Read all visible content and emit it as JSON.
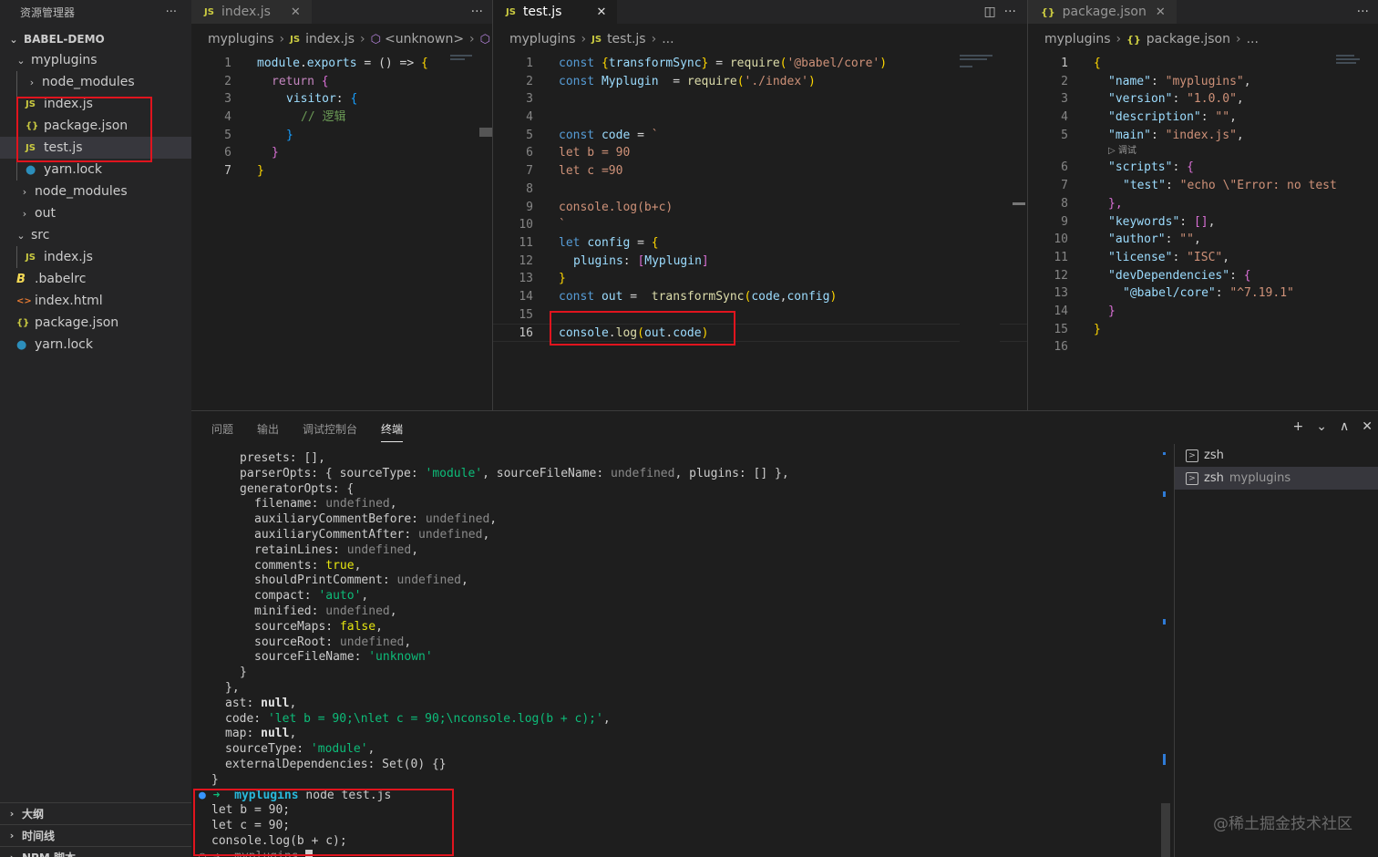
{
  "explorer": {
    "title": "资源管理器",
    "more": "···",
    "project": "BABEL-DEMO",
    "items": [
      {
        "label": "myplugins",
        "type": "folder",
        "open": true
      },
      {
        "label": "node_modules",
        "type": "folder",
        "open": false
      },
      {
        "label": "index.js",
        "type": "js"
      },
      {
        "label": "package.json",
        "type": "json"
      },
      {
        "label": "test.js",
        "type": "js",
        "selected": true
      },
      {
        "label": "yarn.lock",
        "type": "yarn"
      },
      {
        "label": "node_modules",
        "type": "folder",
        "open": false
      },
      {
        "label": "out",
        "type": "folder",
        "open": false
      },
      {
        "label": "src",
        "type": "folder",
        "open": true
      },
      {
        "label": "index.js",
        "type": "js"
      },
      {
        "label": ".babelrc",
        "type": "babel"
      },
      {
        "label": "index.html",
        "type": "html"
      },
      {
        "label": "package.json",
        "type": "json"
      },
      {
        "label": "yarn.lock",
        "type": "yarn"
      }
    ],
    "bottom": [
      "大纲",
      "时间线",
      "NPM 脚本"
    ]
  },
  "editor1": {
    "tab": "index.js",
    "tab_icon": "JS",
    "crumbs": [
      "myplugins",
      "index.js",
      "<unknown>"
    ],
    "lines": [
      "1",
      "2",
      "3",
      "4",
      "5",
      "6",
      "7"
    ],
    "code": {
      "l1a": "module",
      "l1b": ".",
      "l1c": "exports",
      "l1d": " = () => ",
      "l1e": "{",
      "l2a": "return ",
      "l2b": "{",
      "l3a": "visitor",
      "l3b": ": ",
      "l3c": "{",
      "l4": "// 逻辑",
      "l5": "}",
      "l6": "}",
      "l7": "}"
    }
  },
  "editor2": {
    "tab": "test.js",
    "tab_icon": "JS",
    "crumbs": [
      "myplugins",
      "test.js",
      "..."
    ],
    "lines": [
      "1",
      "2",
      "3",
      "4",
      "5",
      "6",
      "7",
      "8",
      "9",
      "10",
      "11",
      "12",
      "13",
      "14",
      "15",
      "16"
    ],
    "code": {
      "l1a": "const ",
      "l1b": "{",
      "l1c": "transformSync",
      "l1d": "}",
      "l1e": " = ",
      "l1f": "require",
      "l1g": "(",
      "l1h": "'@babel/core'",
      "l1i": ")",
      "l2a": "const ",
      "l2b": "Myplugin",
      "l2c": "  = ",
      "l2d": "require",
      "l2e": "(",
      "l2f": "'./index'",
      "l2g": ")",
      "l5a": "const ",
      "l5b": "code",
      "l5c": " = ",
      "l5d": "`",
      "l6": "let b = 90",
      "l7": "let c =90",
      "l9": "console.log(b+c)",
      "l10": "`",
      "l11a": "let ",
      "l11b": "config",
      "l11c": " = ",
      "l11d": "{",
      "l12a": "plugins",
      "l12b": ": ",
      "l12c": "[",
      "l12d": "Myplugin",
      "l12e": "]",
      "l13": "}",
      "l14a": "const ",
      "l14b": "out",
      "l14c": " =  ",
      "l14d": "transformSync",
      "l14e": "(",
      "l14f": "code",
      "l14g": ",",
      "l14h": "config",
      "l14i": ")",
      "l16a": "console",
      "l16b": ".",
      "l16c": "log",
      "l16d": "(",
      "l16e": "out",
      "l16f": ".",
      "l16g": "code",
      "l16h": ")"
    }
  },
  "editor3": {
    "tab": "package.json",
    "tab_icon": "{}",
    "crumbs": [
      "myplugins",
      "package.json",
      "..."
    ],
    "lines": [
      "1",
      "2",
      "3",
      "4",
      "5",
      "6",
      "7",
      "8",
      "9",
      "10",
      "11",
      "12",
      "13",
      "14",
      "15",
      "16"
    ],
    "codelens": "▷ 调试",
    "code": {
      "l1": "{",
      "l2k": "\"name\"",
      "l2v": "\"myplugins\"",
      "l3k": "\"version\"",
      "l3v": "\"1.0.0\"",
      "l4k": "\"description\"",
      "l4v": "\"\"",
      "l5k": "\"main\"",
      "l5v": "\"index.js\"",
      "l6k": "\"scripts\"",
      "l6b": "{",
      "l7k": "\"test\"",
      "l7v": "\"echo \\\"Error: no test",
      "l8": "},",
      "l9k": "\"keywords\"",
      "l9v": "[]",
      "l10k": "\"author\"",
      "l10v": "\"\"",
      "l11k": "\"license\"",
      "l11v": "\"ISC\"",
      "l12k": "\"devDependencies\"",
      "l12b": "{",
      "l13k": "\"@babel/core\"",
      "l13v": "\"^7.19.1\"",
      "l14": "}",
      "l15": "}"
    }
  },
  "panel": {
    "tabs": [
      "问题",
      "输出",
      "调试控制台",
      "终端"
    ],
    "active_tab": "终端",
    "actions": [
      "+",
      "⌄",
      "∧",
      "✕"
    ],
    "terminals": [
      {
        "name": "zsh",
        "sub": ""
      },
      {
        "name": "zsh",
        "sub": "myplugins"
      }
    ],
    "output": {
      "t1": "presets: [],",
      "t2a": "parserOpts: { sourceType: ",
      "t2b": "'module'",
      "t2c": ", sourceFileName: ",
      "t2d": "undefined",
      "t2e": ", plugins: [] },",
      "t3": "generatorOpts: {",
      "t4a": "filename: ",
      "t4b": "undefined",
      "t5a": "auxiliaryCommentBefore: ",
      "t5b": "undefined",
      "t6a": "auxiliaryCommentAfter: ",
      "t6b": "undefined",
      "t7a": "retainLines: ",
      "t7b": "undefined",
      "t8a": "comments: ",
      "t8b": "true",
      "t9a": "shouldPrintComment: ",
      "t9b": "undefined",
      "t10a": "compact: ",
      "t10b": "'auto'",
      "t11a": "minified: ",
      "t11b": "undefined",
      "t12a": "sourceMaps: ",
      "t12b": "false",
      "t13a": "sourceRoot: ",
      "t13b": "undefined",
      "t14a": "sourceFileName: ",
      "t14b": "'unknown'",
      "t15": "}",
      "t16": "},",
      "t17a": "ast: ",
      "t17b": "null",
      "t18a": "code: ",
      "t18b": "'let b = 90;\\nlet c = 90;\\nconsole.log(b + c);'",
      "t19a": "map: ",
      "t19b": "null",
      "t20a": "sourceType: ",
      "t20b": "'module'",
      "t21": "externalDependencies: Set(0) {}",
      "t22": "}",
      "p_dir": "myplugins",
      "p_cmd": " node test.js",
      "r1": "let b = 90;",
      "r2": "let c = 90;",
      "r3": "console.log(b + c);",
      "p2_dir": "myplugins"
    }
  },
  "watermark": "@稀土掘金技术社区",
  "colors": {
    "highlight_box": "#e0141e",
    "accent": "#007acc"
  }
}
